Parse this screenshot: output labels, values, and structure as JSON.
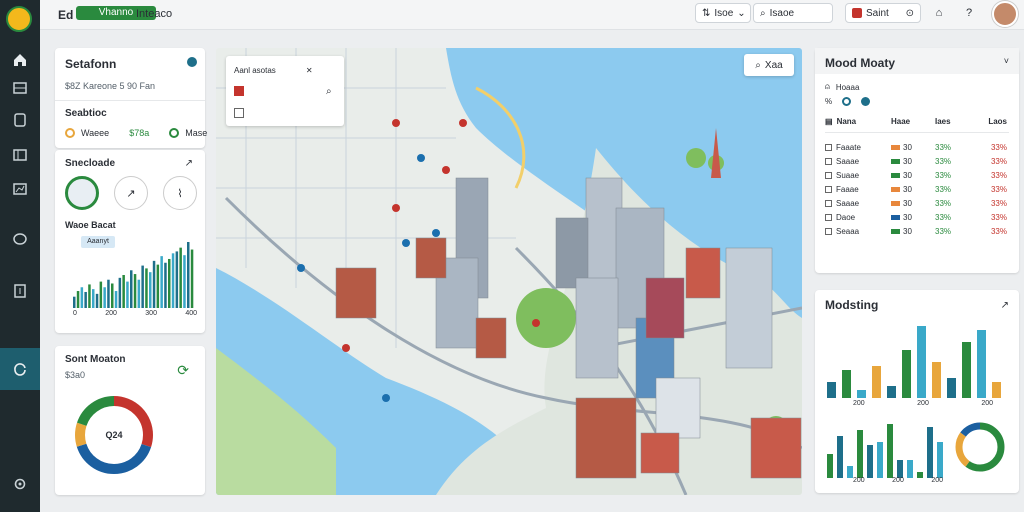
{
  "topbar": {
    "brand": "Ed",
    "brand_pill": "Vhanno",
    "tab": "Inteaco",
    "btn1_label": "Isoe",
    "search_label": "Isaoe",
    "alert_label": "Saint"
  },
  "left_card1": {
    "title": "Setafonn",
    "subtitle": "$8Z Kareone 5 90 Fan",
    "section2": "Seabtioc",
    "items": [
      {
        "label": "Waeee"
      },
      {
        "label": "$78a"
      },
      {
        "label": "Mase"
      }
    ]
  },
  "left_card2": {
    "title": "Snecloade",
    "metric": "Waoe Bacat",
    "chip": "Aaanyt",
    "axis": [
      "0",
      "200",
      "300",
      "400"
    ],
    "chart_data": {
      "type": "bar",
      "values": [
        12,
        18,
        22,
        17,
        25,
        20,
        15,
        28,
        22,
        30,
        26,
        18,
        32,
        35,
        28,
        40,
        36,
        30,
        45,
        42,
        38,
        50,
        46,
        55,
        48,
        52,
        58,
        60,
        64,
        56,
        70,
        62
      ]
    }
  },
  "left_card3": {
    "title": "Sont Moaton",
    "value": "$3a0",
    "donut_label": "Q24",
    "chart_data": {
      "type": "pie",
      "values": [
        30,
        40,
        10,
        20
      ],
      "colors": [
        "#c4342d",
        "#1b5fa0",
        "#e8a63c",
        "#2a8a3e"
      ]
    }
  },
  "map": {
    "legend_items": [
      "Aanl asotas",
      "",
      ""
    ],
    "search_label": "Xaa"
  },
  "right_card1": {
    "title": "Mood Moaty",
    "l1": "Hoaaa",
    "l2": "%",
    "header": [
      "Nana",
      "Haae",
      "Iaes",
      "Laos"
    ],
    "rows": [
      {
        "n": "Faaate",
        "v1": "30",
        "v2": "33%",
        "v3": "33%",
        "c": "#e8873c"
      },
      {
        "n": "Saaae",
        "v1": "30",
        "v2": "33%",
        "v3": "33%",
        "c": "#2a8a3e"
      },
      {
        "n": "Suaae",
        "v1": "30",
        "v2": "33%",
        "v3": "33%",
        "c": "#2a8a3e"
      },
      {
        "n": "Faaae",
        "v1": "30",
        "v2": "33%",
        "v3": "33%",
        "c": "#e8873c"
      },
      {
        "n": "Saaae",
        "v1": "30",
        "v2": "33%",
        "v3": "33%",
        "c": "#e8873c"
      },
      {
        "n": "Daoe",
        "v1": "30",
        "v2": "33%",
        "v3": "33%",
        "c": "#1b5fa0"
      },
      {
        "n": "Seaaa",
        "v1": "30",
        "v2": "33%",
        "v3": "33%",
        "c": "#2a8a3e"
      }
    ]
  },
  "right_card2": {
    "title": "Modsting",
    "x_ticks1": [
      "200",
      "200",
      "200"
    ],
    "x_ticks2": [
      "200",
      "200",
      "200"
    ],
    "chart_data": [
      {
        "type": "bar",
        "values": [
          20,
          35,
          10,
          40,
          15,
          60,
          90,
          45,
          25,
          70,
          85,
          20
        ]
      },
      {
        "type": "bar",
        "values": [
          40,
          70,
          20,
          80,
          55,
          60,
          90,
          30,
          30,
          10,
          85,
          60
        ]
      },
      {
        "type": "pie",
        "values": [
          60,
          25,
          15
        ],
        "colors": [
          "#2a8a3e",
          "#e8a63c",
          "#1b5fa0"
        ]
      }
    ]
  }
}
